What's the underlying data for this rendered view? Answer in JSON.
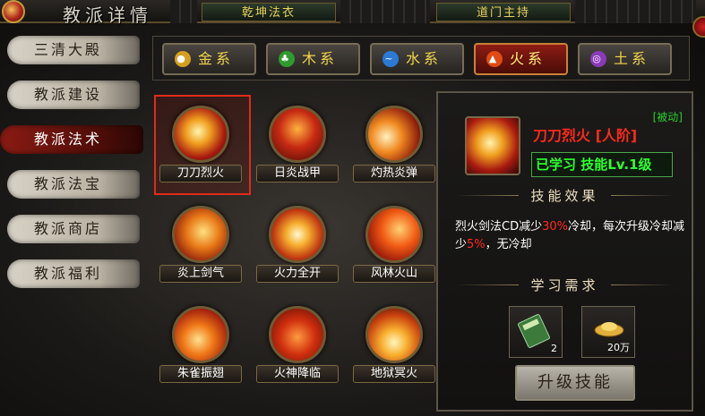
{
  "header": {
    "title": "教派详情",
    "tabs": [
      "乾坤法衣",
      "道门主持"
    ]
  },
  "sidebar": {
    "items": [
      "三清大殿",
      "教派建设",
      "教派法术",
      "教派法宝",
      "教派商店",
      "教派福利"
    ],
    "active_index": 2
  },
  "element_tabs": {
    "items": [
      {
        "label": "金系",
        "icon": "coin-icon",
        "color": "#d4a01e"
      },
      {
        "label": "木系",
        "icon": "leaf-icon",
        "color": "#2f9a2f"
      },
      {
        "label": "水系",
        "icon": "water-icon",
        "color": "#2a7ad4"
      },
      {
        "label": "火系",
        "icon": "fire-icon",
        "color": "#e14a12"
      },
      {
        "label": "土系",
        "icon": "earth-icon",
        "color": "#8a3ab8"
      }
    ],
    "active_index": 3
  },
  "skills": [
    {
      "name": "刀刀烈火"
    },
    {
      "name": "日炎战甲"
    },
    {
      "name": "灼热炎弹"
    },
    {
      "name": "炎上剑气"
    },
    {
      "name": "火力全开"
    },
    {
      "name": "风林火山"
    },
    {
      "name": "朱雀振翅"
    },
    {
      "name": "火神降临"
    },
    {
      "name": "地狱冥火"
    }
  ],
  "selected_skill_index": 0,
  "detail": {
    "passive_tag": "[被动]",
    "skill_name": "刀刀烈火 [人阶]",
    "learned_text": "已学习 技能Lv.1级",
    "effect_heading": "技能效果",
    "desc_part1": "烈火剑法CD减少",
    "desc_hl1": "30%",
    "desc_part2": "冷却，每次升级冷却减少",
    "desc_hl2": "5%",
    "desc_part3": "，无冷却",
    "requirement_heading": "学习需求",
    "requirements": [
      {
        "icon": "skill-book-icon",
        "count": "2"
      },
      {
        "icon": "gold-ingot-icon",
        "count": "20万"
      }
    ],
    "upgrade_label": "升级技能"
  },
  "colors": {
    "highlight_red": "#ff2b1b",
    "learned_green": "#30ff30",
    "selected_border": "#e02b1c"
  }
}
